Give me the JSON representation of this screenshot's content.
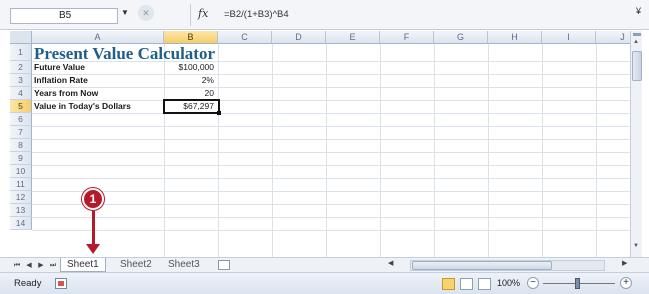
{
  "formula_bar": {
    "name_box": "B5",
    "fx_symbol": "fx",
    "formula": "=B2/(1+B3)^B4"
  },
  "columns": [
    "A",
    "B",
    "C",
    "D",
    "E",
    "F",
    "G",
    "H",
    "I",
    "J"
  ],
  "active_column": "B",
  "rows": [
    "1",
    "2",
    "3",
    "4",
    "5",
    "6",
    "7",
    "8",
    "9",
    "10",
    "11",
    "12",
    "13",
    "14"
  ],
  "active_row": "5",
  "cells": {
    "A1": "Present Value Calculator",
    "A2": "Future Value",
    "B2": "$100,000",
    "A3": "Inflation Rate",
    "B3": "2%",
    "A4": "Years from Now",
    "B4": "20",
    "A5": "Value in Today's Dollars",
    "B5": "$67,297"
  },
  "sheet_tabs": [
    "Sheet1",
    "Sheet2",
    "Sheet3"
  ],
  "active_sheet": "Sheet1",
  "status_bar": {
    "status": "Ready",
    "zoom": "100%"
  },
  "callout": {
    "number": "1",
    "color": "#b51a2a"
  },
  "colors": {
    "title": "#1f5e8a",
    "active_header": "#f6cc68"
  }
}
